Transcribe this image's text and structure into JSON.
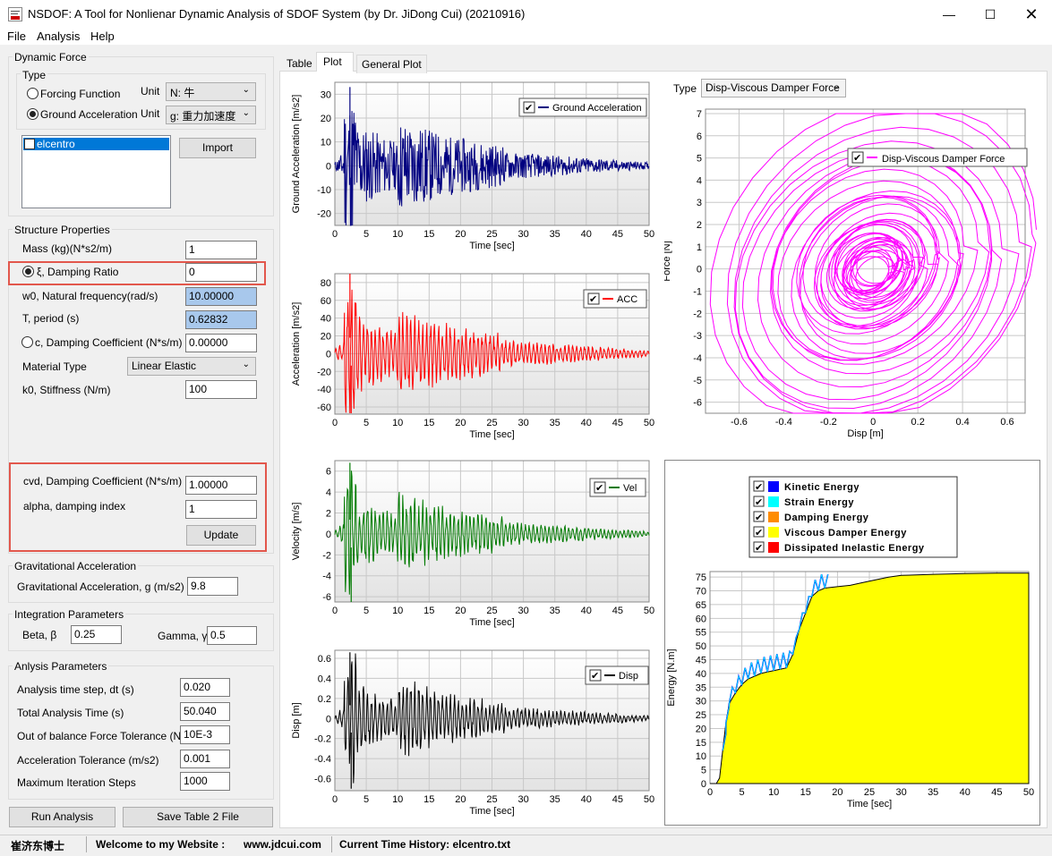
{
  "window": {
    "title": "NSDOF: A Tool for Nonlienar Dynamic Analysis of SDOF System (by Dr. JiDong Cui) (20210916)"
  },
  "menu": [
    "File",
    "Analysis",
    "Help"
  ],
  "dynamic_force": {
    "label": "Dynamic Force",
    "type_label": "Type",
    "forcing_function": "Forcing Function",
    "ground_acceleration": "Ground Acceleration",
    "selected": "ground_acceleration",
    "unit_label": "Unit",
    "force_unit": "N: 牛",
    "accel_unit": "g: 重力加速度",
    "records": [
      "elcentro"
    ],
    "import_label": "Import"
  },
  "structure": {
    "label": "Structure Properties",
    "mass_label": "Mass (kg)(N*s2/m)",
    "mass": "1",
    "damping_ratio_label": "ξ, Damping Ratio",
    "damping_ratio": "0",
    "w0_label": "w0, Natural frequency(rad/s)",
    "w0": "10.00000",
    "period_label": "T, period (s)",
    "period": "0.62832",
    "c_label": "c, Damping Coefficient (N*s/m)",
    "c": "0.00000",
    "material_label": "Material Type",
    "material": "Linear Elastic",
    "k0_label": "k0, Stiffness (N/m)",
    "k0": "100",
    "cvd_label": "cvd, Damping Coefficient (N*s/m)",
    "cvd": "1.00000",
    "alpha_label": "alpha, damping index",
    "alpha": "1",
    "update_label": "Update"
  },
  "gravity": {
    "label": "Gravitational Acceleration",
    "field_label": "Gravitational Acceleration, g (m/s2)",
    "value": "9.8"
  },
  "integration": {
    "label": "Integration Parameters",
    "beta_label": "Beta, β",
    "beta": "0.25",
    "gamma_label": "Gamma, γ",
    "gamma": "0.5"
  },
  "analysis": {
    "label": "Anlysis  Parameters",
    "dt_label": "Analysis time step, dt (s)",
    "dt": "0.020",
    "total_label": "Total Analysis Time (s)",
    "total": "50.040",
    "force_tol_label": "Out of balance Force Tolerance (N)",
    "force_tol": "10E-3",
    "acc_tol_label": "Acceleration Tolerance (m/s2)",
    "acc_tol": "0.001",
    "iter_label": "Maximum Iteration Steps",
    "iter": "1000"
  },
  "buttons": {
    "run": "Run Analysis",
    "save": "Save Table 2 File"
  },
  "tabs": [
    "Table",
    "Plot",
    "General Plot"
  ],
  "active_tab": "Plot",
  "type_select": {
    "label": "Type",
    "value": "Disp-Viscous Damper Force"
  },
  "status": {
    "author": "崔济东博士",
    "welcome": "Welcome to my Website :",
    "site": "www.jdcui.com",
    "history": "Current Time History: elcentro.txt"
  },
  "colors": {
    "ground": "#000080",
    "acc": "#ff0000",
    "vel": "#007a00",
    "disp": "#000000",
    "hyst": "#ff00ff",
    "kinetic": "#0000ff",
    "strain": "#00ffff",
    "damping": "#ff8c00",
    "viscous": "#ffff00",
    "inelastic": "#ff0000",
    "redbox": "#e2574c"
  },
  "chart_data": [
    {
      "type": "line",
      "xlabel": "Time [sec]",
      "ylabel": "Ground Acceleration [m/s2]",
      "xlim": [
        0,
        50
      ],
      "ylim": [
        -25,
        35
      ],
      "xticks": [
        0,
        5,
        10,
        15,
        20,
        25,
        30,
        35,
        40,
        45,
        50
      ],
      "yticks": [
        30,
        20,
        10,
        0,
        -10,
        -20
      ],
      "series": [
        {
          "name": "Ground Acceleration",
          "peak": 33,
          "trough": -25
        }
      ]
    },
    {
      "type": "line",
      "xlabel": "Time [sec]",
      "ylabel": "Acceleration [m/s2]",
      "xlim": [
        0,
        50
      ],
      "ylim": [
        -68,
        90
      ],
      "xticks": [
        0,
        5,
        10,
        15,
        20,
        25,
        30,
        35,
        40,
        45,
        50
      ],
      "yticks": [
        80,
        60,
        40,
        20,
        0,
        -20,
        -40,
        -60
      ],
      "series": [
        {
          "name": "ACC",
          "peak": 90,
          "trough": -67
        }
      ]
    },
    {
      "type": "line",
      "xlabel": "Time [sec]",
      "ylabel": "Velocity [m/s]",
      "xlim": [
        0,
        50
      ],
      "ylim": [
        -6.5,
        7
      ],
      "xticks": [
        0,
        5,
        10,
        15,
        20,
        25,
        30,
        35,
        40,
        45,
        50
      ],
      "yticks": [
        6,
        4,
        2,
        0,
        -2,
        -4,
        -6
      ],
      "series": [
        {
          "name": "Vel",
          "peak": 6.8,
          "trough": -6.5
        }
      ]
    },
    {
      "type": "line",
      "xlabel": "Time [sec]",
      "ylabel": "Disp [m]",
      "xlim": [
        0,
        50
      ],
      "ylim": [
        -0.72,
        0.68
      ],
      "xticks": [
        0,
        5,
        10,
        15,
        20,
        25,
        30,
        35,
        40,
        45,
        50
      ],
      "yticks": [
        0.6,
        0.4,
        0.2,
        0,
        -0.2,
        -0.4,
        -0.6
      ],
      "series": [
        {
          "name": "Disp",
          "peak": 0.66,
          "trough": -0.7
        }
      ]
    },
    {
      "type": "scatter",
      "xlabel": "Disp [m]",
      "ylabel": "Force [N]",
      "xlim": [
        -0.75,
        0.68
      ],
      "ylim": [
        -6.5,
        7.2
      ],
      "xticks": [
        -0.6,
        -0.4,
        -0.2,
        0,
        0.2,
        0.4,
        0.6
      ],
      "yticks": [
        7,
        6,
        5,
        4,
        3,
        2,
        1,
        0,
        -1,
        -2,
        -3,
        -4,
        -5,
        -6
      ],
      "series": [
        {
          "name": "Disp-Viscous Damper Force",
          "disp_range": [
            -0.7,
            0.66
          ],
          "force_range": [
            -6.5,
            7.0
          ]
        }
      ]
    },
    {
      "type": "area",
      "xlabel": "Time [sec]",
      "ylabel": "Energy [N.m]",
      "xlim": [
        0,
        50
      ],
      "ylim": [
        0,
        77
      ],
      "xticks": [
        0,
        5,
        10,
        15,
        20,
        25,
        30,
        35,
        40,
        45,
        50
      ],
      "yticks": [
        75,
        70,
        65,
        60,
        55,
        50,
        45,
        40,
        35,
        30,
        25,
        20,
        15,
        10,
        5,
        0
      ],
      "legend": [
        "Kinetic Energy",
        "Strain Energy",
        "Damping Energy",
        "Viscous Damper Energy",
        "Dissipated Inelastic Energy"
      ],
      "series": [
        {
          "name": "Viscous Damper Energy",
          "x": [
            0,
            1,
            1.5,
            2,
            2.5,
            3,
            4,
            5,
            6,
            7,
            8,
            9,
            10,
            11,
            12,
            13,
            14,
            15,
            16,
            17,
            18,
            20,
            22,
            24,
            26,
            28,
            30,
            35,
            40,
            45,
            50
          ],
          "values": [
            0,
            0,
            2,
            12,
            22,
            29,
            33,
            36,
            38,
            39,
            40,
            40.5,
            41,
            41.5,
            42,
            47,
            56,
            62,
            68,
            70,
            71,
            71.5,
            72,
            73,
            74,
            75,
            75.6,
            76,
            76.3,
            76.4,
            76.4
          ]
        }
      ]
    }
  ]
}
